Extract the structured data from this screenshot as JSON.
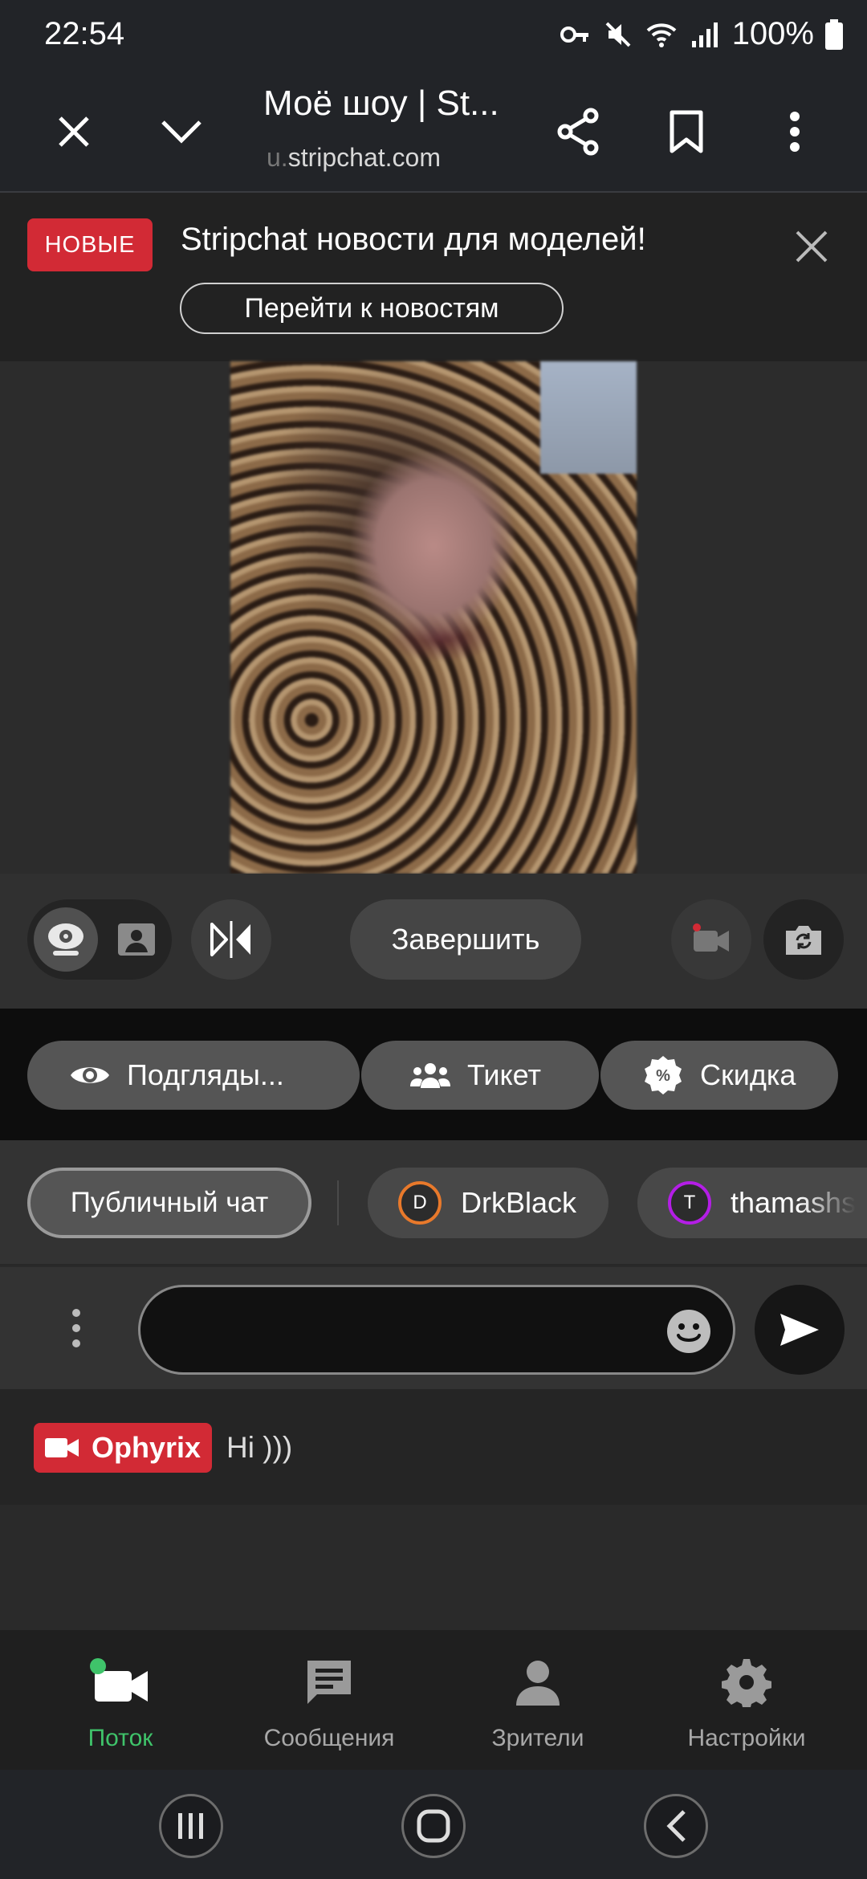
{
  "status_bar": {
    "time": "22:54",
    "battery": "100%"
  },
  "browser": {
    "title": "Моё шоу | St...",
    "url_prefix": "u.",
    "url_domain": "stripchat.com"
  },
  "news": {
    "badge": "НОВЫЕ",
    "headline": "Stripchat новости для моделей!",
    "button": "Перейти к новостям"
  },
  "controls": {
    "end_button": "Завершить"
  },
  "features": [
    {
      "label": "Подгляды...",
      "icon": "eye-icon"
    },
    {
      "label": "Тикет",
      "icon": "group-icon"
    },
    {
      "label": "Скидка",
      "icon": "percent-icon"
    }
  ],
  "chat_tabs": {
    "public": "Публичный чат",
    "users": [
      {
        "initial": "D",
        "name": "DrkBlack",
        "ring_color": "#e8792b"
      },
      {
        "initial": "T",
        "name": "thamashs",
        "ring_color": "#b41ee6"
      }
    ]
  },
  "input": {
    "placeholder": ""
  },
  "messages": [
    {
      "user": "Ophyrix",
      "text": "Hi )))"
    }
  ],
  "bottom_nav": [
    {
      "label": "Поток",
      "icon": "video-camera-icon",
      "active": true
    },
    {
      "label": "Сообщения",
      "icon": "message-icon",
      "active": false
    },
    {
      "label": "Зрители",
      "icon": "person-icon",
      "active": false
    },
    {
      "label": "Настройки",
      "icon": "gear-icon",
      "active": false
    }
  ],
  "colors": {
    "accent_red": "#d22a35",
    "active_green": "#3fc36a"
  }
}
